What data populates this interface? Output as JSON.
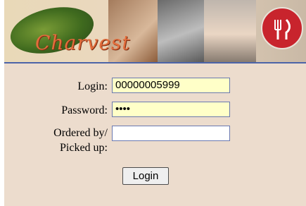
{
  "header": {
    "brand": "Charvest"
  },
  "form": {
    "login_label": "Login:",
    "login_value": "00000005999",
    "password_label": "Password:",
    "password_value": "••••",
    "ordered_label_line1": "Ordered by/",
    "ordered_label_line2": "Picked up:",
    "ordered_value": "",
    "submit_label": "Login"
  },
  "colors": {
    "panel_bg": "#ecdccd",
    "input_fill": "#ffffc8",
    "banner_stripe": "#4c64a8",
    "logo_red": "#c8242d",
    "brand_orange": "#e36d3c"
  }
}
